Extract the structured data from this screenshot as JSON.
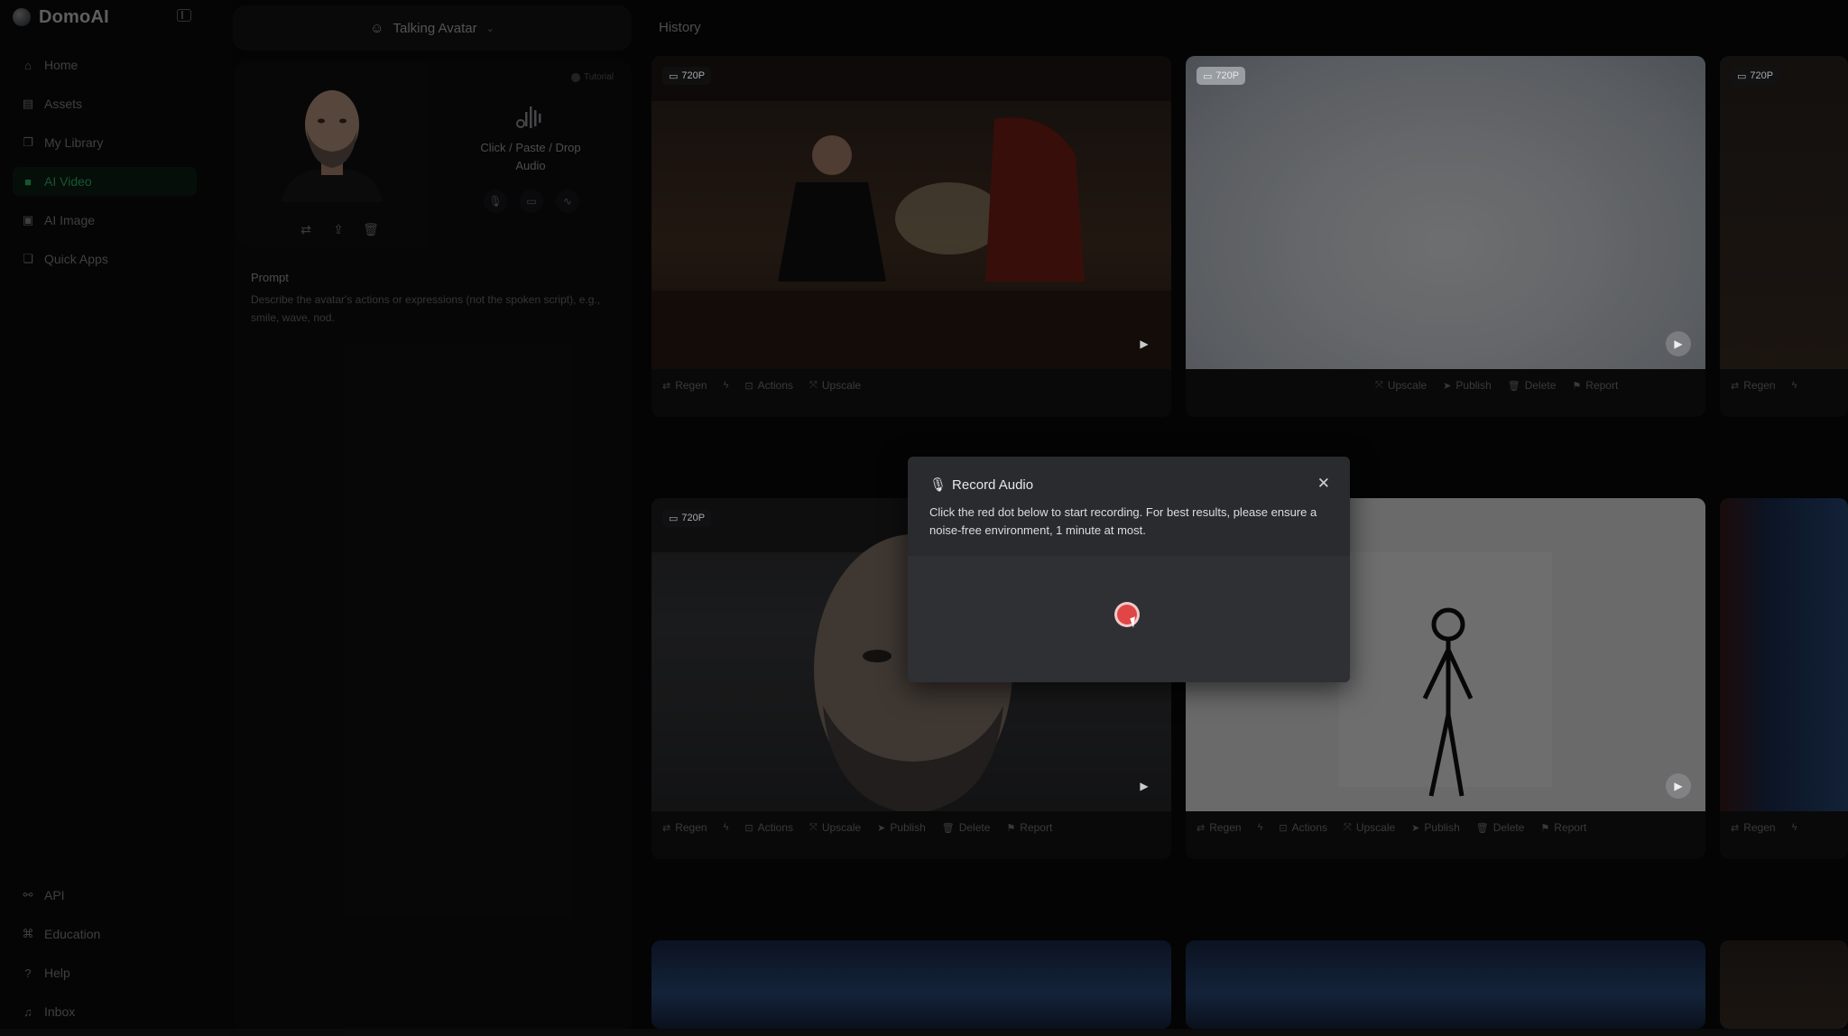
{
  "app": {
    "name": "DomoAI"
  },
  "sidebar": {
    "items": [
      {
        "label": "Home",
        "icon": "home-icon",
        "active": false
      },
      {
        "label": "Assets",
        "icon": "assets-icon",
        "active": false
      },
      {
        "label": "My Library",
        "icon": "library-icon",
        "active": false
      },
      {
        "label": "AI Video",
        "icon": "video-icon",
        "active": true
      },
      {
        "label": "AI Image",
        "icon": "image-icon",
        "active": false
      },
      {
        "label": "Quick Apps",
        "icon": "apps-icon",
        "active": false
      }
    ],
    "bottom_items": [
      {
        "label": "API",
        "icon": "api-icon"
      },
      {
        "label": "Education",
        "icon": "education-icon"
      },
      {
        "label": "Help",
        "icon": "help-icon"
      },
      {
        "label": "Inbox",
        "icon": "bell-icon"
      }
    ],
    "accent_color": "#2fbf6a"
  },
  "left_panel": {
    "mode": "Talking Avatar",
    "tutorial": "Tutorial",
    "audio_upload_text": "Click / Paste / Drop Audio",
    "prompt_label": "Prompt",
    "prompt_placeholder": "Describe the avatar's actions or expressions (not the spoken script), e.g., smile, wave, nod."
  },
  "history": {
    "title": "History",
    "action_labels": {
      "regen": "Regen",
      "actions": "Actions",
      "upscale": "Upscale",
      "publish": "Publish",
      "delete": "Delete",
      "report": "Report"
    },
    "cards": [
      {
        "badge": "720P",
        "scene": "fight"
      },
      {
        "badge": "720P",
        "scene": "light"
      },
      {
        "badge": "720P",
        "scene": "dark"
      },
      {
        "badge": "720P",
        "scene": "face"
      },
      {
        "badge": "",
        "scene": "stick"
      },
      {
        "badge": "",
        "scene": "blue"
      }
    ]
  },
  "modal": {
    "title": "Record Audio",
    "description": "Click the red dot below to start recording. For best results, please ensure a noise-free environment, 1 minute at most.",
    "record_color": "#e04646"
  }
}
